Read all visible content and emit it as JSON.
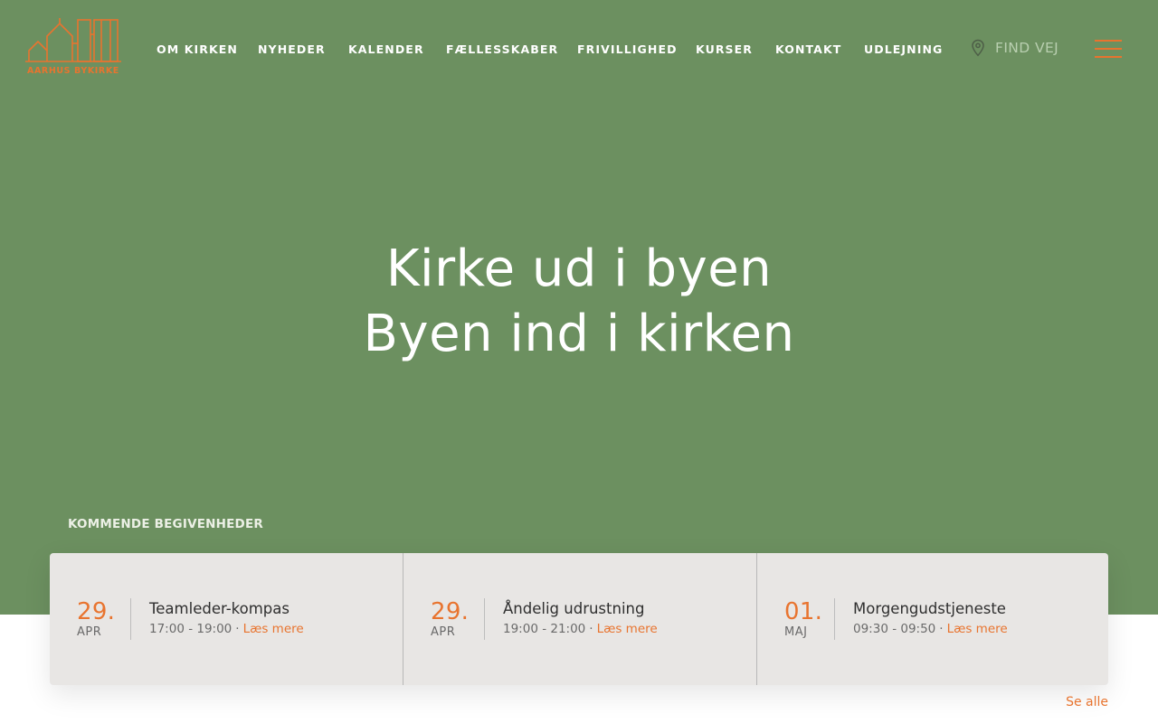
{
  "brand": {
    "logo_text": "AARHUS BYKIRKE",
    "accent_color": "#e8742f",
    "hero_color": "#6c9060"
  },
  "nav": {
    "items": [
      {
        "label": "OM KIRKEN"
      },
      {
        "label": "NYHEDER"
      },
      {
        "label": "KALENDER"
      },
      {
        "label": "FÆLLESSKABER"
      },
      {
        "label": "FRIVILLIGHED"
      },
      {
        "label": "KURSER"
      },
      {
        "label": "KONTAKT"
      },
      {
        "label": "UDLEJNING"
      }
    ],
    "find_vej": "FIND VEJ"
  },
  "hero": {
    "line1": "Kirke ud i byen",
    "line2": "Byen ind i kirken"
  },
  "events": {
    "heading": "KOMMENDE BEGIVENHEDER",
    "items": [
      {
        "day": "29.",
        "month": "APR",
        "title": "Teamleder-kompas",
        "time": "17:00 - 19:00",
        "more": "Læs mere"
      },
      {
        "day": "29.",
        "month": "APR",
        "title": "Åndelig udrustning",
        "time": "19:00 - 21:00",
        "more": "Læs mere"
      },
      {
        "day": "01.",
        "month": "MAJ",
        "title": "Morgengudstjeneste",
        "time": "09:30 - 09:50",
        "more": "Læs mere"
      }
    ],
    "see_all": "Se alle"
  }
}
